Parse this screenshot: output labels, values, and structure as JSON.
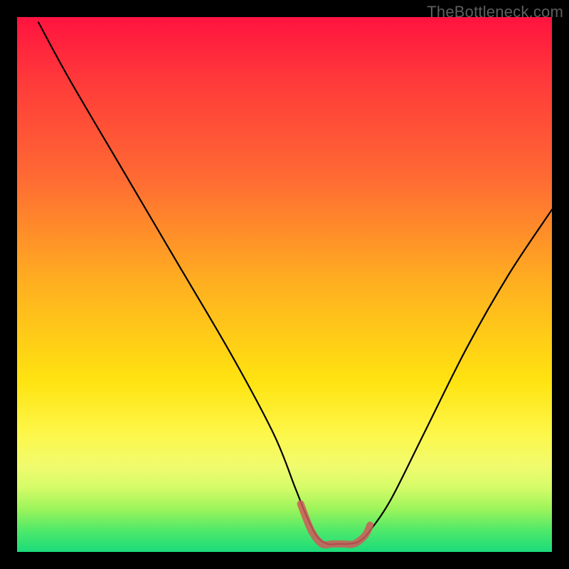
{
  "watermark": "TheBottleneck.com",
  "chart_data": {
    "type": "line",
    "title": "",
    "xlabel": "",
    "ylabel": "",
    "xlim": [
      0,
      100
    ],
    "ylim": [
      0,
      100
    ],
    "grid": false,
    "series": [
      {
        "name": "curve",
        "color": "#000000",
        "x": [
          4,
          10,
          20,
          30,
          40,
          48,
          52,
          54,
          56,
          58,
          60,
          62,
          64,
          66,
          70,
          76,
          84,
          92,
          100
        ],
        "y": [
          99,
          88,
          71,
          54,
          37,
          22,
          12,
          7,
          3,
          1.5,
          1.5,
          1.5,
          2,
          4,
          10,
          22,
          38,
          52,
          64
        ]
      },
      {
        "name": "trough-highlight",
        "color": "#d06060",
        "x": [
          53,
          55,
          57,
          59,
          61,
          63,
          65,
          66
        ],
        "y": [
          9,
          4,
          1.5,
          1.5,
          1.5,
          1.5,
          3,
          5
        ]
      }
    ]
  }
}
